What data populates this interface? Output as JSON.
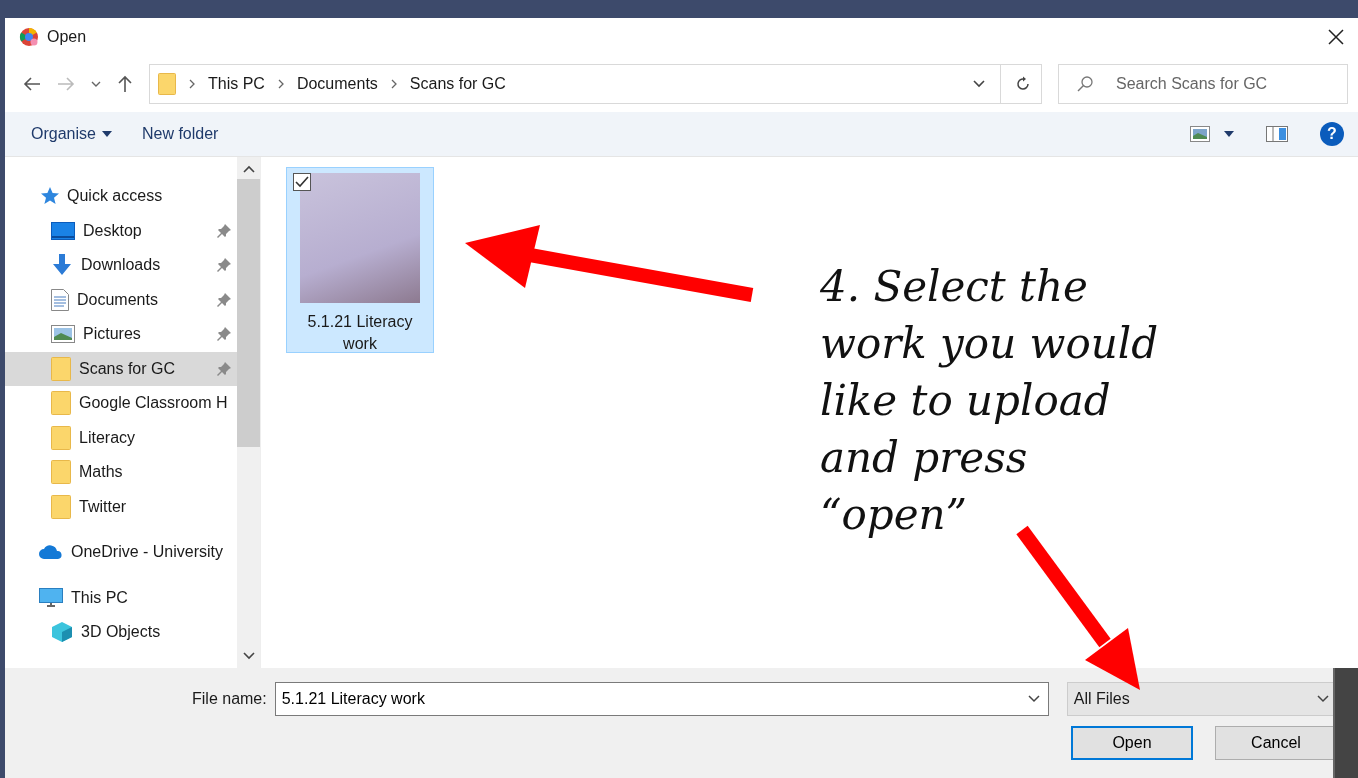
{
  "dialog": {
    "title": "Open"
  },
  "address": {
    "breadcrumbs": [
      "This PC",
      "Documents",
      "Scans for GC"
    ]
  },
  "search": {
    "placeholder": "Search Scans for GC"
  },
  "toolbar": {
    "organise": "Organise",
    "new_folder": "New folder",
    "help": "?"
  },
  "nav": [
    {
      "label": "Quick access",
      "kind": "star",
      "pinned": false,
      "selected": false
    },
    {
      "label": "Desktop",
      "kind": "desktop",
      "pinned": true,
      "selected": false
    },
    {
      "label": "Downloads",
      "kind": "download",
      "pinned": true,
      "selected": false
    },
    {
      "label": "Documents",
      "kind": "document",
      "pinned": true,
      "selected": false
    },
    {
      "label": "Pictures",
      "kind": "picture",
      "pinned": true,
      "selected": false
    },
    {
      "label": "Scans for GC",
      "kind": "folder",
      "pinned": true,
      "selected": true
    },
    {
      "label": "Google Classroom H",
      "kind": "folder",
      "pinned": false,
      "selected": false
    },
    {
      "label": "Literacy",
      "kind": "folder",
      "pinned": false,
      "selected": false
    },
    {
      "label": "Maths",
      "kind": "folder",
      "pinned": false,
      "selected": false
    },
    {
      "label": "Twitter",
      "kind": "folder",
      "pinned": false,
      "selected": false
    },
    {
      "label": "OneDrive - University",
      "kind": "cloud",
      "pinned": false,
      "selected": false
    },
    {
      "label": "This PC",
      "kind": "computer",
      "pinned": false,
      "selected": false
    },
    {
      "label": "3D Objects",
      "kind": "cube",
      "pinned": false,
      "selected": false
    }
  ],
  "files": [
    {
      "name": "5.1.21 Literacy work",
      "selected": true,
      "checked": true
    }
  ],
  "footer": {
    "file_name_label": "File name:",
    "file_name": "5.1.21 Literacy work",
    "filter": "All Files",
    "buttons": [
      {
        "label": "Open",
        "default": true
      },
      {
        "label": "Cancel",
        "default": false
      }
    ]
  },
  "annotation": {
    "lines": [
      "4. Select the",
      "work you would",
      "like to upload",
      "and press",
      "“open”"
    ]
  }
}
